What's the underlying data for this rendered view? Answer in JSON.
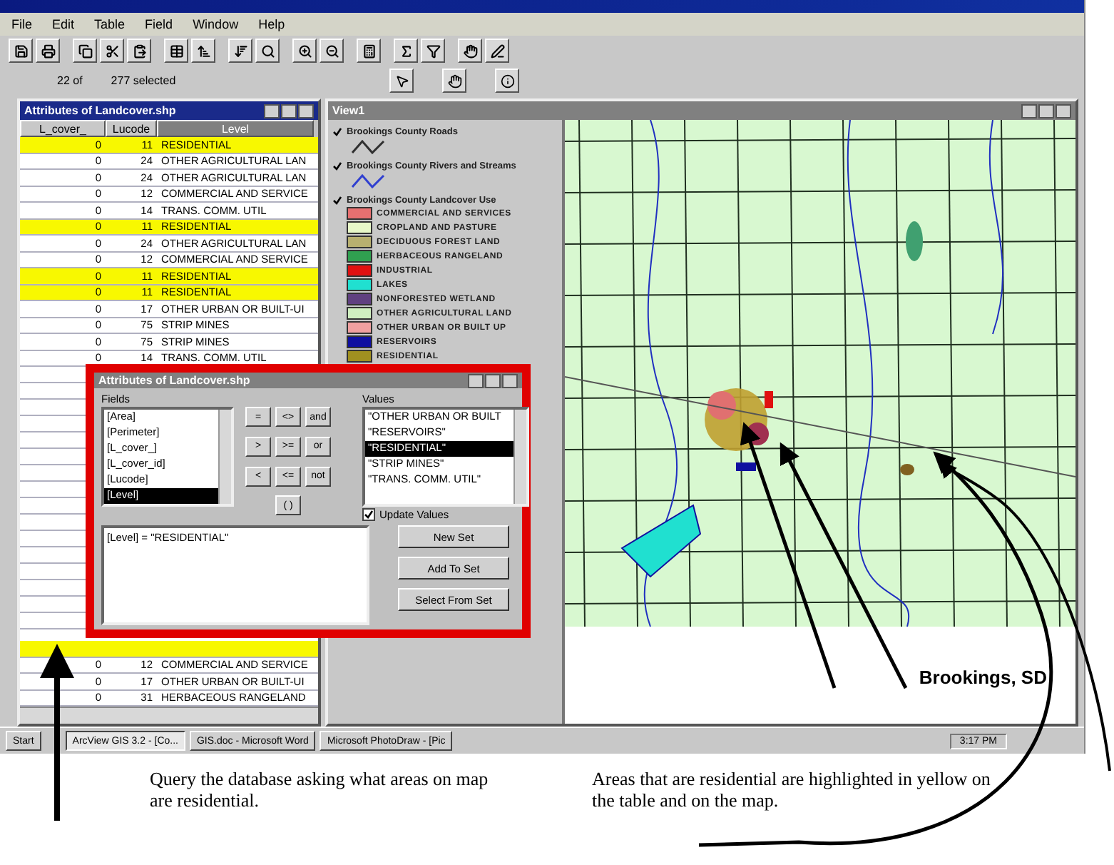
{
  "menu": [
    "File",
    "Edit",
    "Table",
    "Field",
    "Window",
    "Help"
  ],
  "status": {
    "count": "22 of",
    "selected": "277 selected"
  },
  "table_window": {
    "title": "Attributes of Landcover.shp",
    "columns": [
      {
        "label": "L_cover_",
        "selected": false
      },
      {
        "label": "Lucode",
        "selected": false
      },
      {
        "label": "Level",
        "selected": true
      }
    ],
    "top_rows": [
      {
        "lcover": "0",
        "lucode": "11",
        "level": "RESIDENTIAL",
        "selected": true
      },
      {
        "lcover": "0",
        "lucode": "24",
        "level": "OTHER AGRICULTURAL LAN",
        "selected": false
      },
      {
        "lcover": "0",
        "lucode": "24",
        "level": "OTHER AGRICULTURAL LAN",
        "selected": false
      },
      {
        "lcover": "0",
        "lucode": "12",
        "level": "COMMERCIAL AND SERVICE",
        "selected": false
      },
      {
        "lcover": "0",
        "lucode": "14",
        "level": "TRANS. COMM. UTIL",
        "selected": false
      },
      {
        "lcover": "0",
        "lucode": "11",
        "level": "RESIDENTIAL",
        "selected": true
      },
      {
        "lcover": "0",
        "lucode": "24",
        "level": "OTHER AGRICULTURAL LAN",
        "selected": false
      },
      {
        "lcover": "0",
        "lucode": "12",
        "level": "COMMERCIAL AND SERVICE",
        "selected": false
      },
      {
        "lcover": "0",
        "lucode": "11",
        "level": "RESIDENTIAL",
        "selected": true
      },
      {
        "lcover": "0",
        "lucode": "11",
        "level": "RESIDENTIAL",
        "selected": true
      },
      {
        "lcover": "0",
        "lucode": "17",
        "level": "OTHER URBAN OR BUILT-UI",
        "selected": false
      },
      {
        "lcover": "0",
        "lucode": "75",
        "level": "STRIP MINES",
        "selected": false
      },
      {
        "lcover": "0",
        "lucode": "75",
        "level": "STRIP MINES",
        "selected": false
      },
      {
        "lcover": "0",
        "lucode": "14",
        "level": "TRANS. COMM. UTIL",
        "selected": false
      }
    ],
    "bottom_rows": [
      {
        "selected": true
      },
      {
        "lcover": "0",
        "lucode": "12",
        "level": "COMMERCIAL AND SERVICE",
        "selected": false
      },
      {
        "lcover": "0",
        "lucode": "17",
        "level": "OTHER URBAN OR BUILT-UI",
        "selected": false
      },
      {
        "lcover": "0",
        "lucode": "31",
        "level": "HERBACEOUS RANGELAND",
        "selected": false
      }
    ]
  },
  "view_window": {
    "title": "View1",
    "legend": [
      {
        "kind": "line",
        "name": "Brookings County Roads",
        "checked": true,
        "color": "#303030"
      },
      {
        "kind": "line",
        "name": "Brookings County Rivers and Streams",
        "checked": true,
        "color": "#3040d0"
      },
      {
        "kind": "classes",
        "name": "Brookings County Landcover Use",
        "checked": true,
        "classes": [
          {
            "label": "COMMERCIAL AND SERVICES",
            "color": "#e87070"
          },
          {
            "label": "CROPLAND AND PASTURE",
            "color": "#e8f8c8"
          },
          {
            "label": "DECIDUOUS FOREST LAND",
            "color": "#b8b070"
          },
          {
            "label": "HERBACEOUS RANGELAND",
            "color": "#30a050"
          },
          {
            "label": "INDUSTRIAL",
            "color": "#e01010"
          },
          {
            "label": "LAKES",
            "color": "#20e0d0"
          },
          {
            "label": "NONFORESTED WETLAND",
            "color": "#604080"
          },
          {
            "label": "OTHER AGRICULTURAL LAND",
            "color": "#d0f0c0"
          },
          {
            "label": "OTHER URBAN OR BUILT UP",
            "color": "#f0a0a0"
          },
          {
            "label": "RESERVOIRS",
            "color": "#1010a0"
          },
          {
            "label": "RESIDENTIAL",
            "color": "#a09020"
          }
        ]
      }
    ],
    "map_label": "Brookings, SD"
  },
  "query_dialog": {
    "title": "Attributes of Landcover.shp",
    "fields_label": "Fields",
    "fields": [
      {
        "label": "[Area]",
        "selected": false
      },
      {
        "label": "[Perimeter]",
        "selected": false
      },
      {
        "label": "[L_cover_]",
        "selected": false
      },
      {
        "label": "[L_cover_id]",
        "selected": false
      },
      {
        "label": "[Lucode]",
        "selected": false
      },
      {
        "label": "[Level]",
        "selected": true
      }
    ],
    "operators": [
      "=",
      "<>",
      "and",
      ">",
      ">=",
      "or",
      "<",
      "<=",
      "not",
      "( )"
    ],
    "values_label": "Values",
    "values": [
      {
        "label": "\"OTHER URBAN OR BUILT",
        "selected": false
      },
      {
        "label": "\"RESERVOIRS\"",
        "selected": false
      },
      {
        "label": "\"RESIDENTIAL\"",
        "selected": true
      },
      {
        "label": "\"STRIP MINES\"",
        "selected": false
      },
      {
        "label": "\"TRANS. COMM. UTIL\"",
        "selected": false
      }
    ],
    "update_values": {
      "label": "Update Values",
      "checked": true
    },
    "expression": "[Level] = \"RESIDENTIAL\"",
    "buttons": [
      "New Set",
      "Add To Set",
      "Select From Set"
    ]
  },
  "taskbar": {
    "start": "Start",
    "items": [
      {
        "label": "ArcView GIS 3.2 - [Co...",
        "selected": true
      },
      {
        "label": "GIS.doc - Microsoft Word",
        "selected": false
      },
      {
        "label": "Microsoft PhotoDraw - [Pic",
        "selected": false
      }
    ],
    "clock": "3:17 PM"
  },
  "annotations": [
    {
      "text": "Query the database asking what areas on map are residential."
    },
    {
      "text": "Areas that are residential are highlighted in yellow on the table and on the map."
    }
  ]
}
